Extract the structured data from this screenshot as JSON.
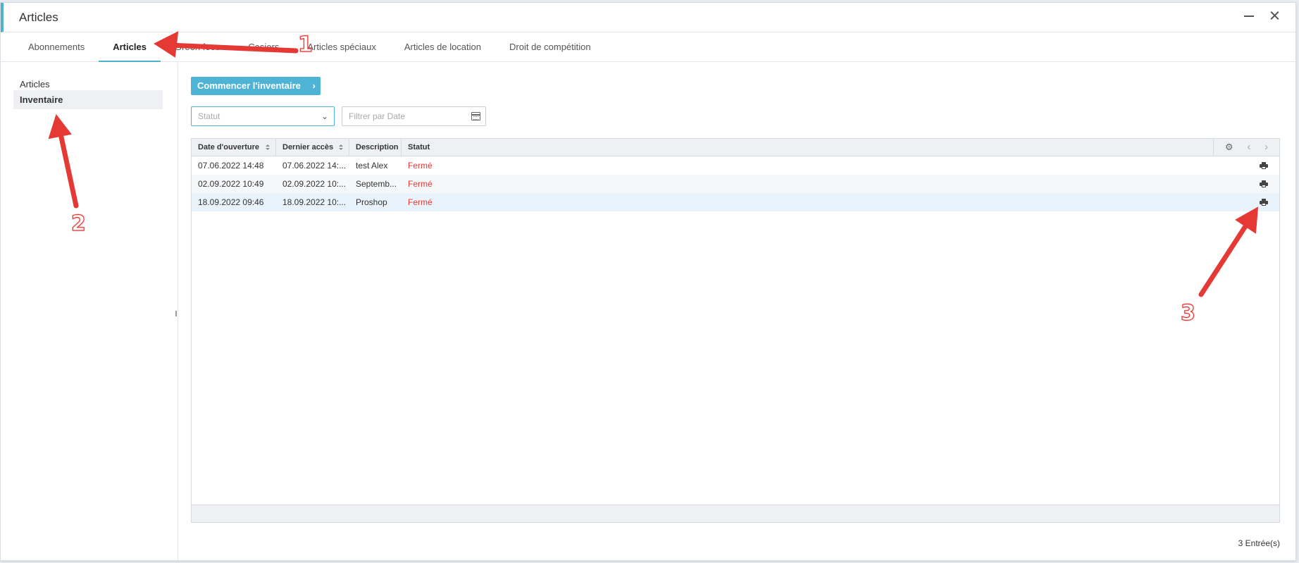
{
  "window": {
    "title": "Articles"
  },
  "tabs": [
    {
      "label": "Abonnements"
    },
    {
      "label": "Articles"
    },
    {
      "label": "Green fees"
    },
    {
      "label": "Casiers"
    },
    {
      "label": "Articles spéciaux"
    },
    {
      "label": "Articles de location"
    },
    {
      "label": "Droit de compétition"
    }
  ],
  "sidebar": {
    "items": [
      {
        "label": "Articles"
      },
      {
        "label": "Inventaire"
      }
    ]
  },
  "toolbar": {
    "start_label": "Commencer l'inventaire"
  },
  "filters": {
    "status_placeholder": "Statut",
    "date_placeholder": "Filtrer par Date"
  },
  "table": {
    "columns": [
      "Date d'ouverture",
      "Dernier accès",
      "Description",
      "Statut"
    ],
    "rows": [
      {
        "opened": "07.06.2022 14:48",
        "last_access": "07.06.2022 14:...",
        "description": "test Alex",
        "status": "Fermé"
      },
      {
        "opened": "02.09.2022 10:49",
        "last_access": "02.09.2022 10:...",
        "description": "Septemb...",
        "status": "Fermé"
      },
      {
        "opened": "18.09.2022 09:46",
        "last_access": "18.09.2022 10:...",
        "description": "Proshop",
        "status": "Fermé"
      }
    ]
  },
  "footer": {
    "entries": "3 Entrée(s)"
  },
  "annotations": [
    {
      "label": "1"
    },
    {
      "label": "2"
    },
    {
      "label": "3"
    }
  ],
  "colors": {
    "accent": "#4fb3d6",
    "status_closed": "#e53935",
    "annotation": "#e53935"
  }
}
